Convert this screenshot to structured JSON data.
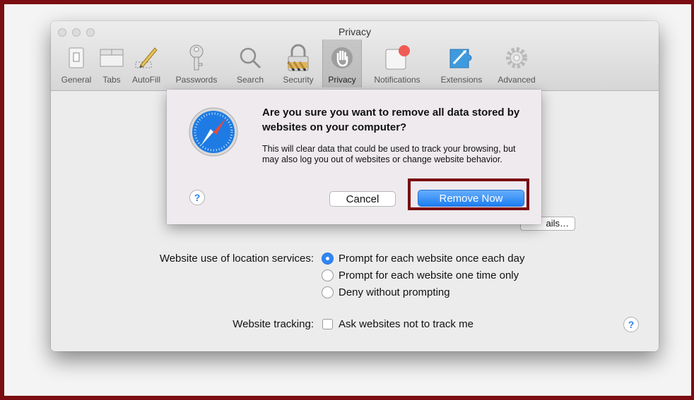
{
  "window": {
    "title": "Privacy"
  },
  "toolbar": {
    "items": [
      {
        "label": "General",
        "icon": "general-switch-icon"
      },
      {
        "label": "Tabs",
        "icon": "tabs-icon"
      },
      {
        "label": "AutoFill",
        "icon": "pencil-icon"
      },
      {
        "label": "Passwords",
        "icon": "key-icon"
      },
      {
        "label": "Search",
        "icon": "magnifier-icon"
      },
      {
        "label": "Security",
        "icon": "padlock-icon"
      },
      {
        "label": "Privacy",
        "icon": "hand-icon",
        "selected": true
      },
      {
        "label": "Notifications",
        "icon": "notifications-icon"
      },
      {
        "label": "Extensions",
        "icon": "puzzle-icon"
      },
      {
        "label": "Advanced",
        "icon": "gear-icon"
      }
    ]
  },
  "dialog": {
    "icon": "safari-compass-icon",
    "title": "Are you sure you want to remove all data stored by websites on your computer?",
    "body": "This will clear data that could be used to track your browsing, but may also log you out of websites or change website behavior.",
    "help": "?",
    "cancel_label": "Cancel",
    "confirm_label": "Remove Now"
  },
  "privacy": {
    "details_button_partial": "ails…",
    "location_label": "Website use of location services:",
    "location_options": [
      {
        "label": "Prompt for each website once each day",
        "selected": true
      },
      {
        "label": "Prompt for each website one time only",
        "selected": false
      },
      {
        "label": "Deny without prompting",
        "selected": false
      }
    ],
    "tracking_label": "Website tracking:",
    "tracking_option": "Ask websites not to track me",
    "tracking_checked": false,
    "help": "?"
  },
  "colors": {
    "annotation": "#7a0e12",
    "accent": "#2f86f6"
  }
}
